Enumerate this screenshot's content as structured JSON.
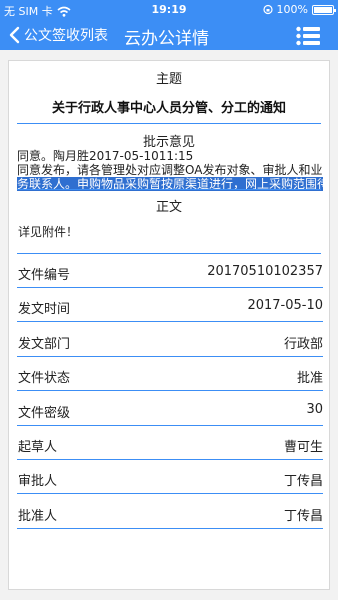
{
  "status": {
    "carrier": "无 SIM 卡",
    "time": "19:19",
    "battery": "100%"
  },
  "nav": {
    "back_label": "公文签收列表",
    "title": "云办公详情"
  },
  "doc": {
    "subject_header": "主题",
    "subject": "关于行政人事中心人员分管、分工的通知",
    "opinion_header": "批示意见",
    "opinion_line1": "同意。陶月胜2017-05-1011:15",
    "opinion_line2": "同意发布，请各管理处对应调整OA发布对象、审批人和业",
    "opinion_line3": "务联系人。申购物品采购暂按原渠道进行，网上采购范围待",
    "body_header": "正文",
    "body_text": "详见附件！"
  },
  "fields": [
    {
      "label": "文件编号",
      "value": "20170510102357"
    },
    {
      "label": "发文时间",
      "value": "2017-05-10"
    },
    {
      "label": "发文部门",
      "value": "行政部"
    },
    {
      "label": "文件状态",
      "value": "批准"
    },
    {
      "label": "文件密级",
      "value": "30"
    },
    {
      "label": "起草人",
      "value": "曹可生"
    },
    {
      "label": "审批人",
      "value": "丁传昌"
    },
    {
      "label": "批准人",
      "value": "丁传昌"
    }
  ]
}
